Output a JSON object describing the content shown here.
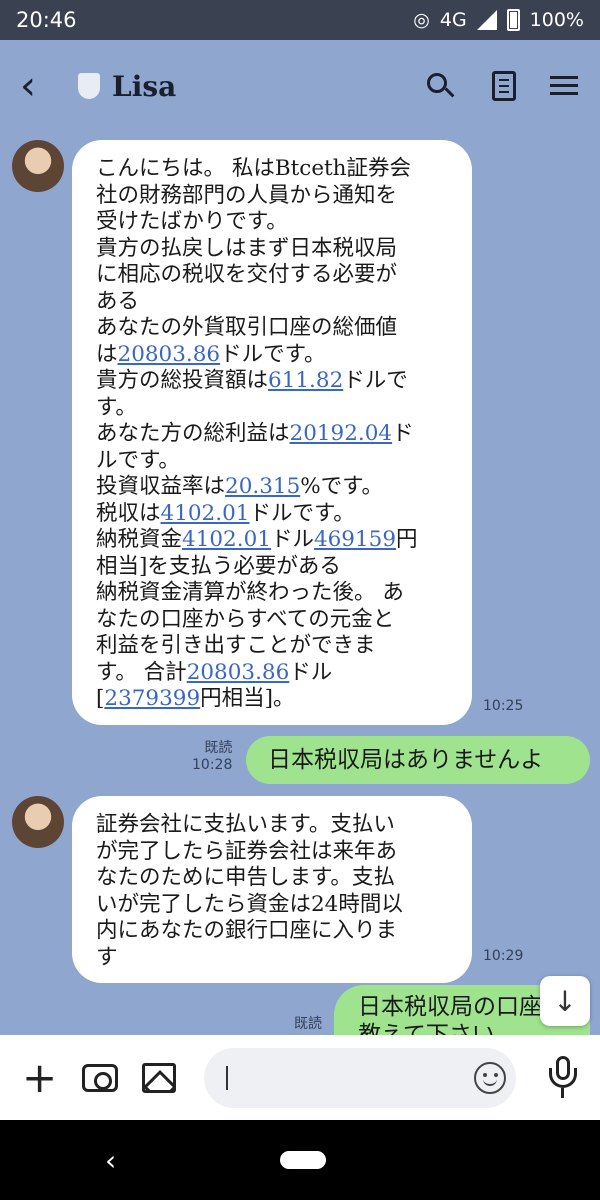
{
  "status": {
    "time": "20:46",
    "network": "4G",
    "battery": "100%"
  },
  "header": {
    "contact_name": "Lisa"
  },
  "messages": {
    "m1": {
      "lines": [
        [
          {
            "t": "こんにちは。 私はBtceth証券会"
          }
        ],
        [
          {
            "t": "社の財務部門の人員から通知を"
          }
        ],
        [
          {
            "t": "受けたばかりです。"
          }
        ],
        [
          {
            "t": "貴方の払戻しはまず日本税収局"
          }
        ],
        [
          {
            "t": "に相応の税収を交付する必要が"
          }
        ],
        [
          {
            "t": "ある"
          }
        ],
        [
          {
            "t": "あなたの外貨取引口座の総価値"
          }
        ],
        [
          {
            "t": "は"
          },
          {
            "t": "20803.86",
            "link": true
          },
          {
            "t": "ドルです。"
          }
        ],
        [
          {
            "t": "貴方の総投資額は"
          },
          {
            "t": "611.82",
            "link": true
          },
          {
            "t": "ドルで"
          }
        ],
        [
          {
            "t": "す。"
          }
        ],
        [
          {
            "t": "あなた方の総利益は"
          },
          {
            "t": "20192.04",
            "link": true
          },
          {
            "t": "ド"
          }
        ],
        [
          {
            "t": "ルです。"
          }
        ],
        [
          {
            "t": "投資収益率は"
          },
          {
            "t": "20.315",
            "link": true
          },
          {
            "t": "%です。"
          }
        ],
        [
          {
            "t": "税収は"
          },
          {
            "t": "4102.01",
            "link": true
          },
          {
            "t": "ドルです。"
          }
        ],
        [
          {
            "t": "納税資金"
          },
          {
            "t": "4102.01",
            "link": true
          },
          {
            "t": "ドル"
          },
          {
            "t": "469159",
            "link": true
          },
          {
            "t": "円"
          }
        ],
        [
          {
            "t": "相当]を支払う必要がある"
          }
        ],
        [
          {
            "t": "納税資金清算が終わった後。 あ"
          }
        ],
        [
          {
            "t": "なたの口座からすべての元金と"
          }
        ],
        [
          {
            "t": "利益を引き出すことができま"
          }
        ],
        [
          {
            "t": "す。 合計"
          },
          {
            "t": "20803.86",
            "link": true
          },
          {
            "t": "ドル"
          }
        ],
        [
          {
            "t": "["
          },
          {
            "t": "2379399",
            "link": true
          },
          {
            "t": "円相当]。"
          }
        ]
      ],
      "time": "10:25"
    },
    "m2": {
      "read": "既読",
      "time": "10:28",
      "text": "日本税収局はありませんよ"
    },
    "m3": {
      "lines": [
        [
          {
            "t": "証券会社に支払います。支払い"
          }
        ],
        [
          {
            "t": "が完了したら証券会社は来年あ"
          }
        ],
        [
          {
            "t": "なたのために申告します。支払"
          }
        ],
        [
          {
            "t": "いが完了したら資金は24時間以"
          }
        ],
        [
          {
            "t": "内にあなたの銀行口座に入りま"
          }
        ],
        [
          {
            "t": "す"
          }
        ]
      ],
      "time": "10:29"
    },
    "m4": {
      "read": "既読",
      "line1": "日本税収局の口座",
      "line2": "教えて下さい"
    }
  },
  "input": {
    "placeholder": ""
  }
}
